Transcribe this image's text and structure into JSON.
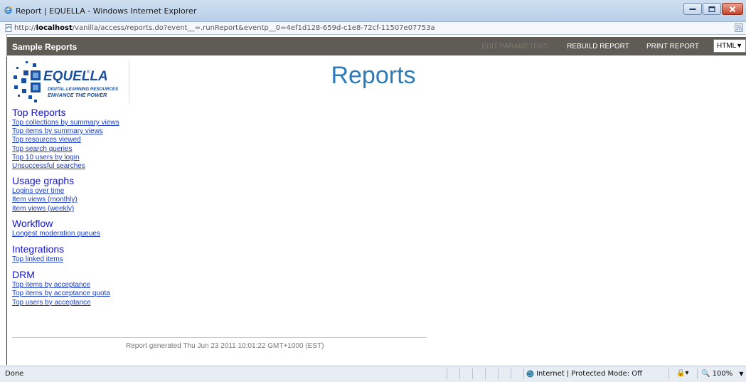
{
  "window": {
    "title": "Report | EQUELLA - Windows Internet Explorer",
    "url_prefix": "http://",
    "url_host": "localhost",
    "url_rest": "/vanilla/access/reports.do?event__=.runReport&eventp__0=4ef1d128-659d-c1e8-72cf-11507e07753a"
  },
  "toolbar": {
    "title": "Sample Reports",
    "edit_parameters": "EDIT PARAMETERS",
    "rebuild_report": "REBUILD REPORT",
    "print_report": "PRINT REPORT",
    "format_value": "HTML",
    "format_arrow": "▼"
  },
  "logo": {
    "name": "EQUELLA",
    "tagline1": "DIGITAL LEARNING RESOURCES",
    "tagline2": "ENHANCE THE POWER"
  },
  "page_title": "Reports",
  "sections": [
    {
      "title": "Top Reports",
      "links": [
        "Top collections by summary views",
        "Top items by summary views",
        "Top resources viewed",
        "Top search queries",
        "Top 10 users by login",
        "Unsuccessful searches"
      ]
    },
    {
      "title": "Usage graphs",
      "links": [
        "Logins over time",
        "Item views (monthly)",
        "Item views (weekly)"
      ]
    },
    {
      "title": "Workflow",
      "links": [
        "Longest moderation queues"
      ]
    },
    {
      "title": "Integrations",
      "links": [
        "Top linked items"
      ]
    },
    {
      "title": "DRM",
      "links": [
        "Top items by acceptance",
        "Top items by acceptance quota",
        "Top users by acceptance"
      ]
    }
  ],
  "footer": "Report generated Thu Jun 23 2011 10:01:22 GMT+1000 (EST)",
  "statusbar": {
    "status": "Done",
    "zone": "Internet | Protected Mode: Off",
    "protected_glyph": "🔒▾",
    "zoom": "100%",
    "zoom_icon": "🔍",
    "zoom_arrow": "▼"
  },
  "colors": {
    "toolbar_bg": "#5f5b55",
    "title_blue": "#2e7bb8",
    "section_blue": "#1515cc",
    "link_blue": "#1a3cc8"
  }
}
